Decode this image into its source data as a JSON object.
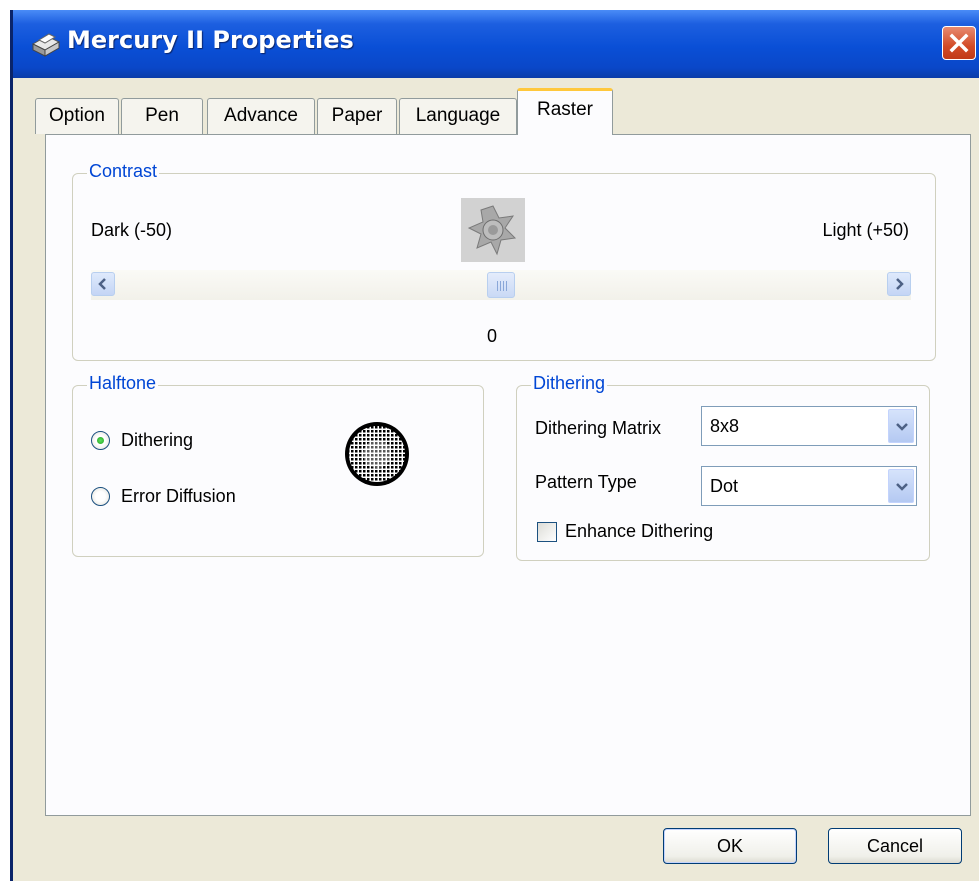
{
  "window": {
    "title": "Mercury II Properties"
  },
  "tabs": [
    {
      "label": "Option",
      "active": false
    },
    {
      "label": "Pen",
      "active": false
    },
    {
      "label": "Advance",
      "active": false
    },
    {
      "label": "Paper",
      "active": false
    },
    {
      "label": "Language",
      "active": false
    },
    {
      "label": "Raster",
      "active": true
    }
  ],
  "contrast": {
    "legend": "Contrast",
    "dark_label": "Dark (-50)",
    "light_label": "Light (+50)",
    "value": "0",
    "slider_min": -50,
    "slider_max": 50,
    "slider_value": 0
  },
  "halftone": {
    "legend": "Halftone",
    "options": [
      {
        "label": "Dithering",
        "checked": true
      },
      {
        "label": "Error Diffusion",
        "checked": false
      }
    ]
  },
  "dithering": {
    "legend": "Dithering",
    "matrix_label": "Dithering Matrix",
    "matrix_value": "8x8",
    "pattern_label": "Pattern Type",
    "pattern_value": "Dot",
    "enhance_label": "Enhance Dithering",
    "enhance_checked": false
  },
  "buttons": {
    "ok": "OK",
    "cancel": "Cancel"
  },
  "colors": {
    "title_bar": "#0a47c8",
    "legend_text": "#0046d5",
    "active_tab_accent": "#ffc83c",
    "close_button": "#d24b27"
  }
}
